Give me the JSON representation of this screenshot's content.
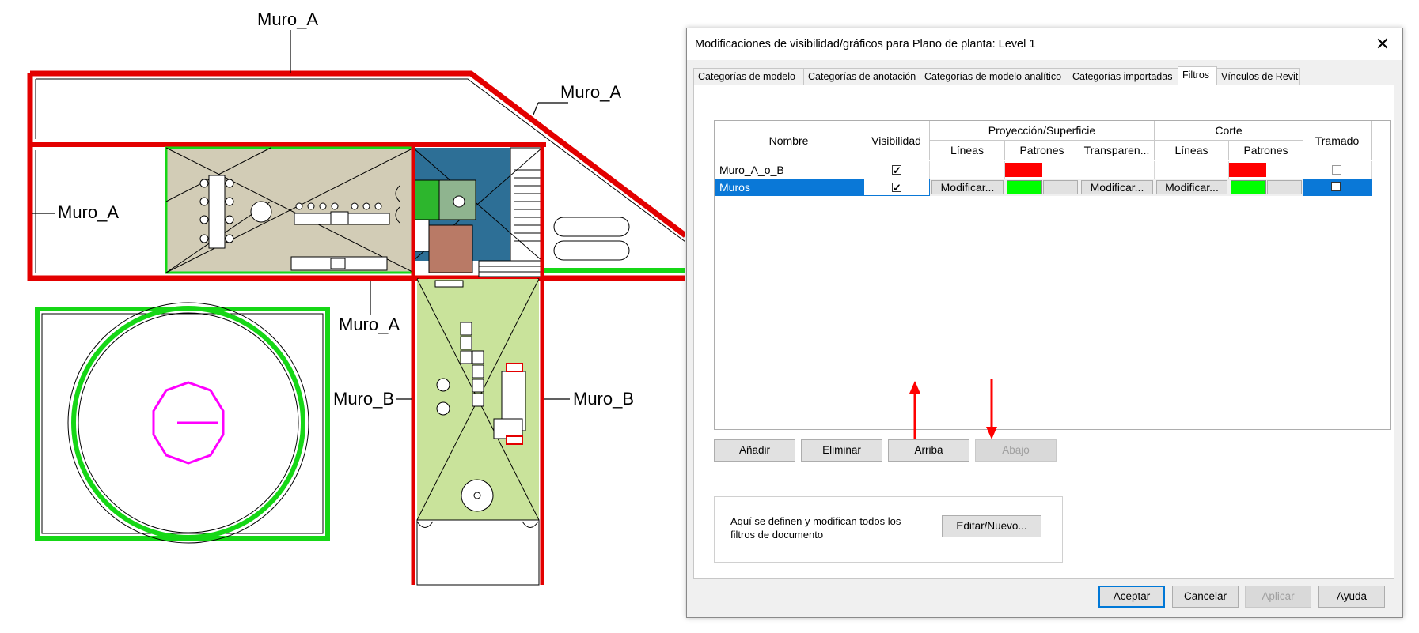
{
  "drawing": {
    "wall_labels": [
      "Muro_A",
      "Muro_A",
      "Muro_A",
      "Muro_A",
      "Muro_B",
      "Muro_B"
    ],
    "colors": {
      "muro_a": "#e30000",
      "muro_b": "#16d716",
      "kitchen_floor": "#d2ccb6",
      "garden_floor": "#c9e39b",
      "stair_room": "#2d6f96",
      "bath_green": "#2db62d",
      "bath_brown": "#b97a66",
      "circle_magenta": "#ff00ff"
    }
  },
  "dialog": {
    "title": "Modificaciones de visibilidad/gráficos para Plano de planta: Level 1",
    "close_icon": "close-icon",
    "tabs": [
      {
        "label": "Categorías de modelo",
        "active": false
      },
      {
        "label": "Categorías de anotación",
        "active": false
      },
      {
        "label": "Categorías de modelo analítico",
        "active": false
      },
      {
        "label": "Categorías importadas",
        "active": false
      },
      {
        "label": "Filtros",
        "active": true
      },
      {
        "label": "Vínculos de Revit",
        "active": false
      }
    ],
    "grid": {
      "headers": {
        "nombre": "Nombre",
        "visibilidad": "Visibilidad",
        "proyeccion": "Proyección/Superficie",
        "proj_lineas": "Líneas",
        "proj_patrones": "Patrones",
        "proj_transparencia": "Transparen...",
        "corte": "Corte",
        "corte_lineas": "Líneas",
        "corte_patrones": "Patrones",
        "tramado": "Tramado"
      },
      "rows": [
        {
          "name": "Muro_A_o_B",
          "visible": true,
          "proj_lineas": "",
          "proj_patrones_color": "#ff0000",
          "transparencia": "",
          "corte_lineas": "",
          "corte_patrones_color": "#ff0000",
          "tramado": false,
          "selected": false
        },
        {
          "name": "Muros",
          "visible": true,
          "proj_lineas": "Modificar...",
          "proj_patrones_color": "#00ff00",
          "transparencia": "Modificar...",
          "corte_lineas": "Modificar...",
          "corte_patrones_color": "#00ff00",
          "tramado": false,
          "selected": true
        }
      ]
    },
    "arrow_color": "#ff0000",
    "buttons": {
      "anadir": "Añadir",
      "eliminar": "Eliminar",
      "arriba": "Arriba",
      "abajo": "Abajo"
    },
    "info_text": "Aquí se definen y modifican todos los filtros de documento",
    "edit_button": "Editar/Nuevo...",
    "footer": {
      "aceptar": "Aceptar",
      "cancelar": "Cancelar",
      "aplicar": "Aplicar",
      "ayuda": "Ayuda"
    }
  }
}
